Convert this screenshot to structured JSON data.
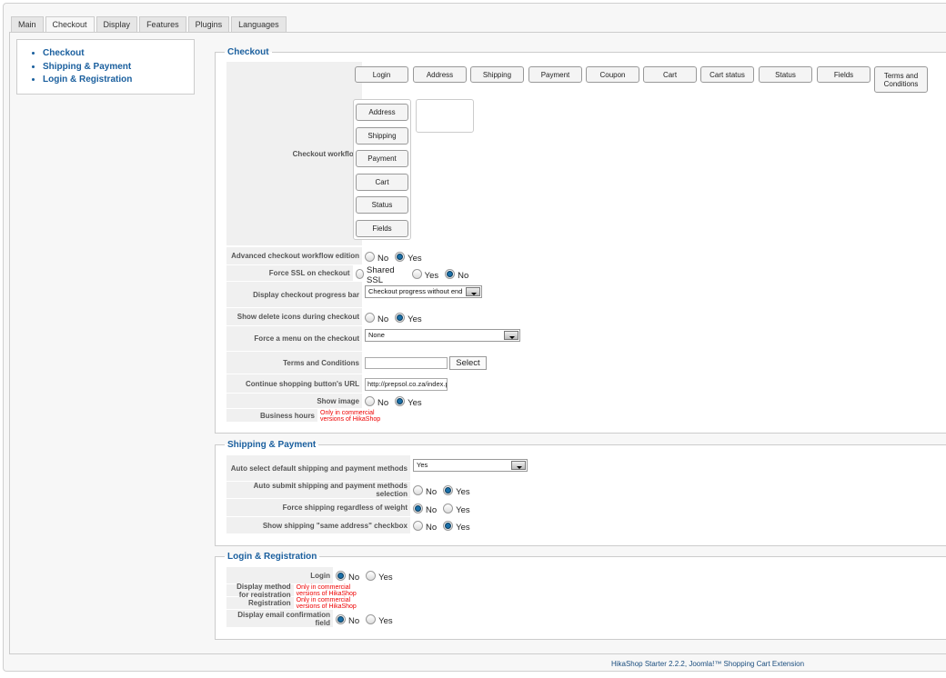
{
  "tabs": [
    "Main",
    "Checkout",
    "Display",
    "Features",
    "Plugins",
    "Languages"
  ],
  "active_tab": "Checkout",
  "sidebar": {
    "items": [
      "Checkout",
      "Shipping & Payment",
      "Login & Registration"
    ]
  },
  "checkout": {
    "legend": "Checkout",
    "workflow_label": "Checkout workflow",
    "available_buttons": [
      "Login",
      "Address",
      "Shipping",
      "Payment",
      "Coupon",
      "Cart",
      "Cart status",
      "Status",
      "Fields",
      "Terms and Conditions"
    ],
    "workflow_steps": [
      "Address",
      "Shipping",
      "Payment",
      "Cart",
      "Status",
      "Fields"
    ],
    "advanced": {
      "label": "Advanced checkout workflow edition",
      "options": [
        "No",
        "Yes"
      ],
      "selected": "Yes"
    },
    "force_ssl": {
      "label": "Force SSL on checkout",
      "options": [
        "Shared SSL",
        "Yes",
        "No"
      ],
      "selected": "No"
    },
    "progress_bar": {
      "label": "Display checkout progress bar",
      "value": "Checkout progress without end"
    },
    "delete_icons": {
      "label": "Show delete icons during checkout",
      "options": [
        "No",
        "Yes"
      ],
      "selected": "Yes"
    },
    "force_menu": {
      "label": "Force a menu on the checkout",
      "value": "None"
    },
    "terms": {
      "label": "Terms and Conditions",
      "value": "",
      "button": "Select"
    },
    "continue_url": {
      "label": "Continue shopping button's URL",
      "value": "http://prepsol.co.za/index.p"
    },
    "show_image": {
      "label": "Show image",
      "options": [
        "No",
        "Yes"
      ],
      "selected": "Yes"
    },
    "business_hours": {
      "label": "Business hours",
      "note": "Only in commercial versions of HikaShop"
    }
  },
  "shipping": {
    "legend": "Shipping & Payment",
    "auto_select": {
      "label": "Auto select default shipping and payment methods",
      "value": "Yes"
    },
    "auto_submit": {
      "label": "Auto submit shipping and payment methods selection",
      "options": [
        "No",
        "Yes"
      ],
      "selected": "Yes"
    },
    "force_shipping": {
      "label": "Force shipping regardless of weight",
      "options": [
        "No",
        "Yes"
      ],
      "selected": "No"
    },
    "same_address": {
      "label": "Show shipping \"same address\" checkbox",
      "options": [
        "No",
        "Yes"
      ],
      "selected": "Yes"
    }
  },
  "login": {
    "legend": "Login & Registration",
    "login": {
      "label": "Login",
      "options": [
        "No",
        "Yes"
      ],
      "selected": "No"
    },
    "display_method": {
      "label": "Display method for registration",
      "note": "Only in commercial versions of HikaShop"
    },
    "registration": {
      "label": "Registration",
      "note": "Only in commercial versions of HikaShop"
    },
    "email_confirm": {
      "label": "Display email confirmation field",
      "options": [
        "No",
        "Yes"
      ],
      "selected": "No"
    }
  },
  "footer": "HikaShop Starter 2.2.2, Joomla!™ Shopping Cart Extension",
  "colors": {
    "accent": "#1a5f9e",
    "radio_selected": "#1a6fa8",
    "note": "#ee0000"
  }
}
